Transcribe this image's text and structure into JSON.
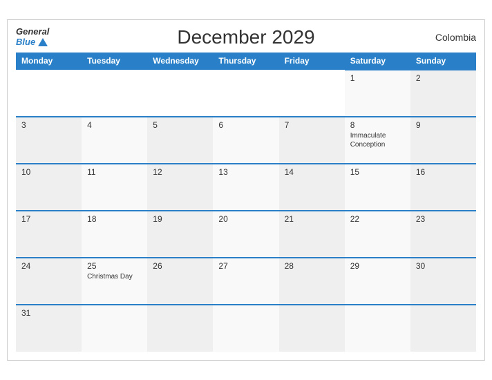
{
  "header": {
    "title": "December 2029",
    "country": "Colombia",
    "logo_general": "General",
    "logo_blue": "Blue"
  },
  "weekdays": [
    "Monday",
    "Tuesday",
    "Wednesday",
    "Thursday",
    "Friday",
    "Saturday",
    "Sunday"
  ],
  "weeks": [
    [
      {
        "day": "",
        "holiday": ""
      },
      {
        "day": "",
        "holiday": ""
      },
      {
        "day": "",
        "holiday": ""
      },
      {
        "day": "",
        "holiday": ""
      },
      {
        "day": "",
        "holiday": ""
      },
      {
        "day": "1",
        "holiday": ""
      },
      {
        "day": "2",
        "holiday": ""
      }
    ],
    [
      {
        "day": "3",
        "holiday": ""
      },
      {
        "day": "4",
        "holiday": ""
      },
      {
        "day": "5",
        "holiday": ""
      },
      {
        "day": "6",
        "holiday": ""
      },
      {
        "day": "7",
        "holiday": ""
      },
      {
        "day": "8",
        "holiday": "Immaculate\nConception"
      },
      {
        "day": "9",
        "holiday": ""
      }
    ],
    [
      {
        "day": "10",
        "holiday": ""
      },
      {
        "day": "11",
        "holiday": ""
      },
      {
        "day": "12",
        "holiday": ""
      },
      {
        "day": "13",
        "holiday": ""
      },
      {
        "day": "14",
        "holiday": ""
      },
      {
        "day": "15",
        "holiday": ""
      },
      {
        "day": "16",
        "holiday": ""
      }
    ],
    [
      {
        "day": "17",
        "holiday": ""
      },
      {
        "day": "18",
        "holiday": ""
      },
      {
        "day": "19",
        "holiday": ""
      },
      {
        "day": "20",
        "holiday": ""
      },
      {
        "day": "21",
        "holiday": ""
      },
      {
        "day": "22",
        "holiday": ""
      },
      {
        "day": "23",
        "holiday": ""
      }
    ],
    [
      {
        "day": "24",
        "holiday": ""
      },
      {
        "day": "25",
        "holiday": "Christmas Day"
      },
      {
        "day": "26",
        "holiday": ""
      },
      {
        "day": "27",
        "holiday": ""
      },
      {
        "day": "28",
        "holiday": ""
      },
      {
        "day": "29",
        "holiday": ""
      },
      {
        "day": "30",
        "holiday": ""
      }
    ],
    [
      {
        "day": "31",
        "holiday": ""
      },
      {
        "day": "",
        "holiday": ""
      },
      {
        "day": "",
        "holiday": ""
      },
      {
        "day": "",
        "holiday": ""
      },
      {
        "day": "",
        "holiday": ""
      },
      {
        "day": "",
        "holiday": ""
      },
      {
        "day": "",
        "holiday": ""
      }
    ]
  ]
}
